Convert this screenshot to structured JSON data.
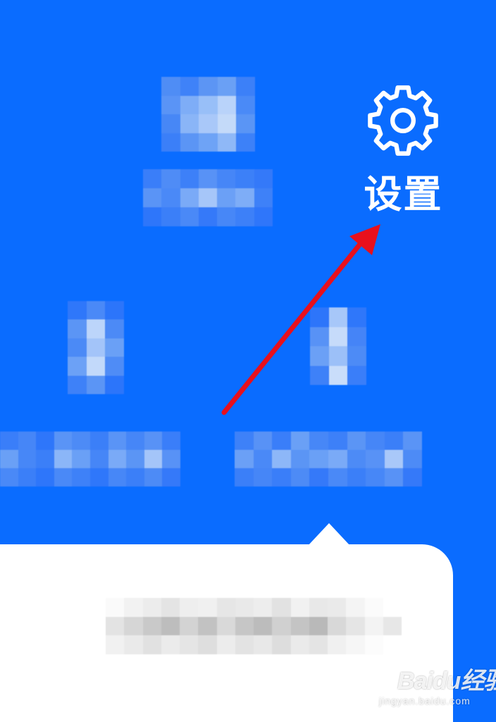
{
  "settings": {
    "label": "设置",
    "icon": "gear-icon"
  },
  "watermark": {
    "logo_text": "Baidu经验",
    "sub_text": "jingyan.baidu.com"
  },
  "colors": {
    "background": "#0A6CFF",
    "card": "#FFFFFF",
    "annotation_arrow": "#E8101C"
  }
}
